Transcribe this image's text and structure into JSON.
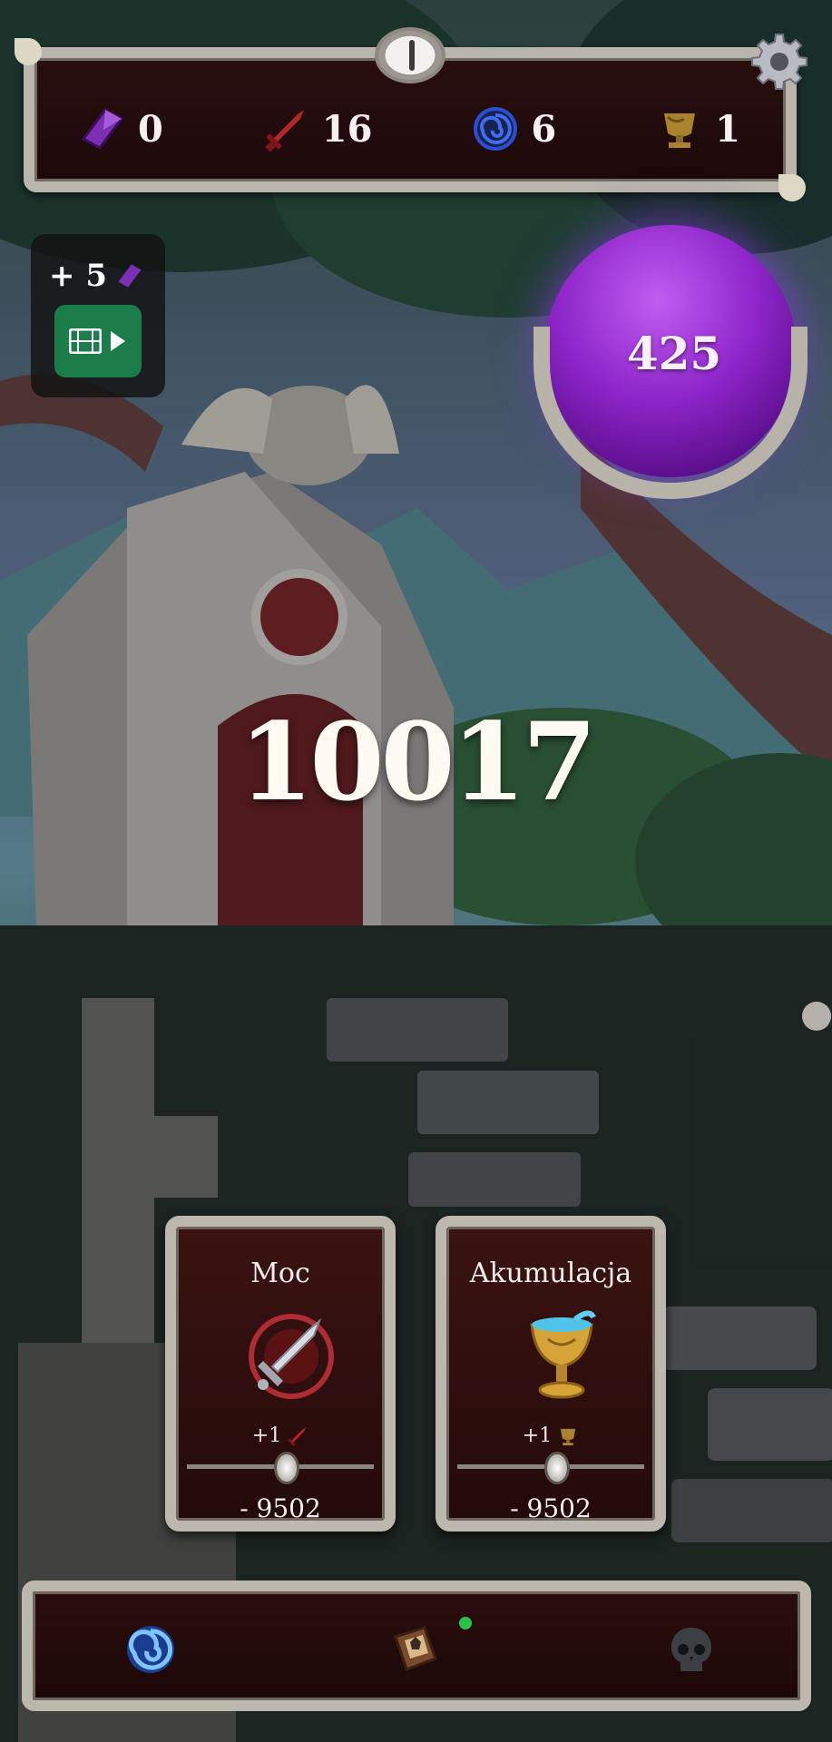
{
  "resources": {
    "crystals": "0",
    "swords": "16",
    "portals": "6",
    "trophies": "1"
  },
  "ad_reward": {
    "amount": "+ 5",
    "icon": "crystal-icon"
  },
  "orb": {
    "value": "425"
  },
  "main_counter": "10017",
  "upgrades": [
    {
      "title": "Moc",
      "gain": "+1",
      "gain_icon": "sword-icon",
      "cost": "- 9502"
    },
    {
      "title": "Akumulacja",
      "gain": "+1",
      "gain_icon": "trophy-icon",
      "cost": "- 9502"
    }
  ],
  "bottom_nav": [
    {
      "icon": "portal-icon"
    },
    {
      "icon": "spellbook-icon",
      "has_notification": true
    },
    {
      "icon": "skull-icon"
    }
  ],
  "colors": {
    "crystal": "#7b2fb3",
    "sword": "#b0262a",
    "portal": "#2b4fd1",
    "trophy": "#a9822a",
    "orb": "#8d25c9",
    "ad_button": "#1c7c4a",
    "notification": "#2dbf47"
  }
}
